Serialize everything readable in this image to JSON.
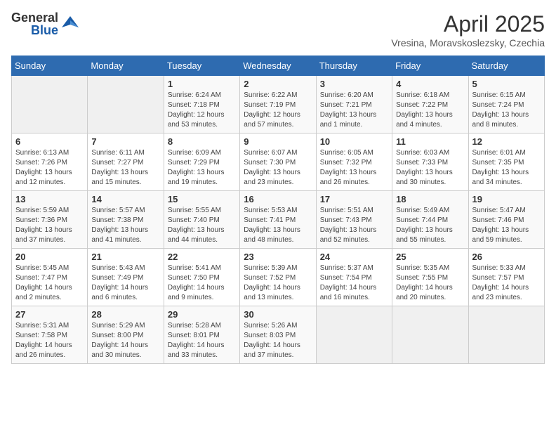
{
  "header": {
    "logo_general": "General",
    "logo_blue": "Blue",
    "month_year": "April 2025",
    "location": "Vresina, Moravskoslezsky, Czechia"
  },
  "days_of_week": [
    "Sunday",
    "Monday",
    "Tuesday",
    "Wednesday",
    "Thursday",
    "Friday",
    "Saturday"
  ],
  "weeks": [
    [
      {
        "day": "",
        "sunrise": "",
        "sunset": "",
        "daylight": ""
      },
      {
        "day": "",
        "sunrise": "",
        "sunset": "",
        "daylight": ""
      },
      {
        "day": "1",
        "sunrise": "Sunrise: 6:24 AM",
        "sunset": "Sunset: 7:18 PM",
        "daylight": "Daylight: 12 hours and 53 minutes."
      },
      {
        "day": "2",
        "sunrise": "Sunrise: 6:22 AM",
        "sunset": "Sunset: 7:19 PM",
        "daylight": "Daylight: 12 hours and 57 minutes."
      },
      {
        "day": "3",
        "sunrise": "Sunrise: 6:20 AM",
        "sunset": "Sunset: 7:21 PM",
        "daylight": "Daylight: 13 hours and 1 minute."
      },
      {
        "day": "4",
        "sunrise": "Sunrise: 6:18 AM",
        "sunset": "Sunset: 7:22 PM",
        "daylight": "Daylight: 13 hours and 4 minutes."
      },
      {
        "day": "5",
        "sunrise": "Sunrise: 6:15 AM",
        "sunset": "Sunset: 7:24 PM",
        "daylight": "Daylight: 13 hours and 8 minutes."
      }
    ],
    [
      {
        "day": "6",
        "sunrise": "Sunrise: 6:13 AM",
        "sunset": "Sunset: 7:26 PM",
        "daylight": "Daylight: 13 hours and 12 minutes."
      },
      {
        "day": "7",
        "sunrise": "Sunrise: 6:11 AM",
        "sunset": "Sunset: 7:27 PM",
        "daylight": "Daylight: 13 hours and 15 minutes."
      },
      {
        "day": "8",
        "sunrise": "Sunrise: 6:09 AM",
        "sunset": "Sunset: 7:29 PM",
        "daylight": "Daylight: 13 hours and 19 minutes."
      },
      {
        "day": "9",
        "sunrise": "Sunrise: 6:07 AM",
        "sunset": "Sunset: 7:30 PM",
        "daylight": "Daylight: 13 hours and 23 minutes."
      },
      {
        "day": "10",
        "sunrise": "Sunrise: 6:05 AM",
        "sunset": "Sunset: 7:32 PM",
        "daylight": "Daylight: 13 hours and 26 minutes."
      },
      {
        "day": "11",
        "sunrise": "Sunrise: 6:03 AM",
        "sunset": "Sunset: 7:33 PM",
        "daylight": "Daylight: 13 hours and 30 minutes."
      },
      {
        "day": "12",
        "sunrise": "Sunrise: 6:01 AM",
        "sunset": "Sunset: 7:35 PM",
        "daylight": "Daylight: 13 hours and 34 minutes."
      }
    ],
    [
      {
        "day": "13",
        "sunrise": "Sunrise: 5:59 AM",
        "sunset": "Sunset: 7:36 PM",
        "daylight": "Daylight: 13 hours and 37 minutes."
      },
      {
        "day": "14",
        "sunrise": "Sunrise: 5:57 AM",
        "sunset": "Sunset: 7:38 PM",
        "daylight": "Daylight: 13 hours and 41 minutes."
      },
      {
        "day": "15",
        "sunrise": "Sunrise: 5:55 AM",
        "sunset": "Sunset: 7:40 PM",
        "daylight": "Daylight: 13 hours and 44 minutes."
      },
      {
        "day": "16",
        "sunrise": "Sunrise: 5:53 AM",
        "sunset": "Sunset: 7:41 PM",
        "daylight": "Daylight: 13 hours and 48 minutes."
      },
      {
        "day": "17",
        "sunrise": "Sunrise: 5:51 AM",
        "sunset": "Sunset: 7:43 PM",
        "daylight": "Daylight: 13 hours and 52 minutes."
      },
      {
        "day": "18",
        "sunrise": "Sunrise: 5:49 AM",
        "sunset": "Sunset: 7:44 PM",
        "daylight": "Daylight: 13 hours and 55 minutes."
      },
      {
        "day": "19",
        "sunrise": "Sunrise: 5:47 AM",
        "sunset": "Sunset: 7:46 PM",
        "daylight": "Daylight: 13 hours and 59 minutes."
      }
    ],
    [
      {
        "day": "20",
        "sunrise": "Sunrise: 5:45 AM",
        "sunset": "Sunset: 7:47 PM",
        "daylight": "Daylight: 14 hours and 2 minutes."
      },
      {
        "day": "21",
        "sunrise": "Sunrise: 5:43 AM",
        "sunset": "Sunset: 7:49 PM",
        "daylight": "Daylight: 14 hours and 6 minutes."
      },
      {
        "day": "22",
        "sunrise": "Sunrise: 5:41 AM",
        "sunset": "Sunset: 7:50 PM",
        "daylight": "Daylight: 14 hours and 9 minutes."
      },
      {
        "day": "23",
        "sunrise": "Sunrise: 5:39 AM",
        "sunset": "Sunset: 7:52 PM",
        "daylight": "Daylight: 14 hours and 13 minutes."
      },
      {
        "day": "24",
        "sunrise": "Sunrise: 5:37 AM",
        "sunset": "Sunset: 7:54 PM",
        "daylight": "Daylight: 14 hours and 16 minutes."
      },
      {
        "day": "25",
        "sunrise": "Sunrise: 5:35 AM",
        "sunset": "Sunset: 7:55 PM",
        "daylight": "Daylight: 14 hours and 20 minutes."
      },
      {
        "day": "26",
        "sunrise": "Sunrise: 5:33 AM",
        "sunset": "Sunset: 7:57 PM",
        "daylight": "Daylight: 14 hours and 23 minutes."
      }
    ],
    [
      {
        "day": "27",
        "sunrise": "Sunrise: 5:31 AM",
        "sunset": "Sunset: 7:58 PM",
        "daylight": "Daylight: 14 hours and 26 minutes."
      },
      {
        "day": "28",
        "sunrise": "Sunrise: 5:29 AM",
        "sunset": "Sunset: 8:00 PM",
        "daylight": "Daylight: 14 hours and 30 minutes."
      },
      {
        "day": "29",
        "sunrise": "Sunrise: 5:28 AM",
        "sunset": "Sunset: 8:01 PM",
        "daylight": "Daylight: 14 hours and 33 minutes."
      },
      {
        "day": "30",
        "sunrise": "Sunrise: 5:26 AM",
        "sunset": "Sunset: 8:03 PM",
        "daylight": "Daylight: 14 hours and 37 minutes."
      },
      {
        "day": "",
        "sunrise": "",
        "sunset": "",
        "daylight": ""
      },
      {
        "day": "",
        "sunrise": "",
        "sunset": "",
        "daylight": ""
      },
      {
        "day": "",
        "sunrise": "",
        "sunset": "",
        "daylight": ""
      }
    ]
  ]
}
